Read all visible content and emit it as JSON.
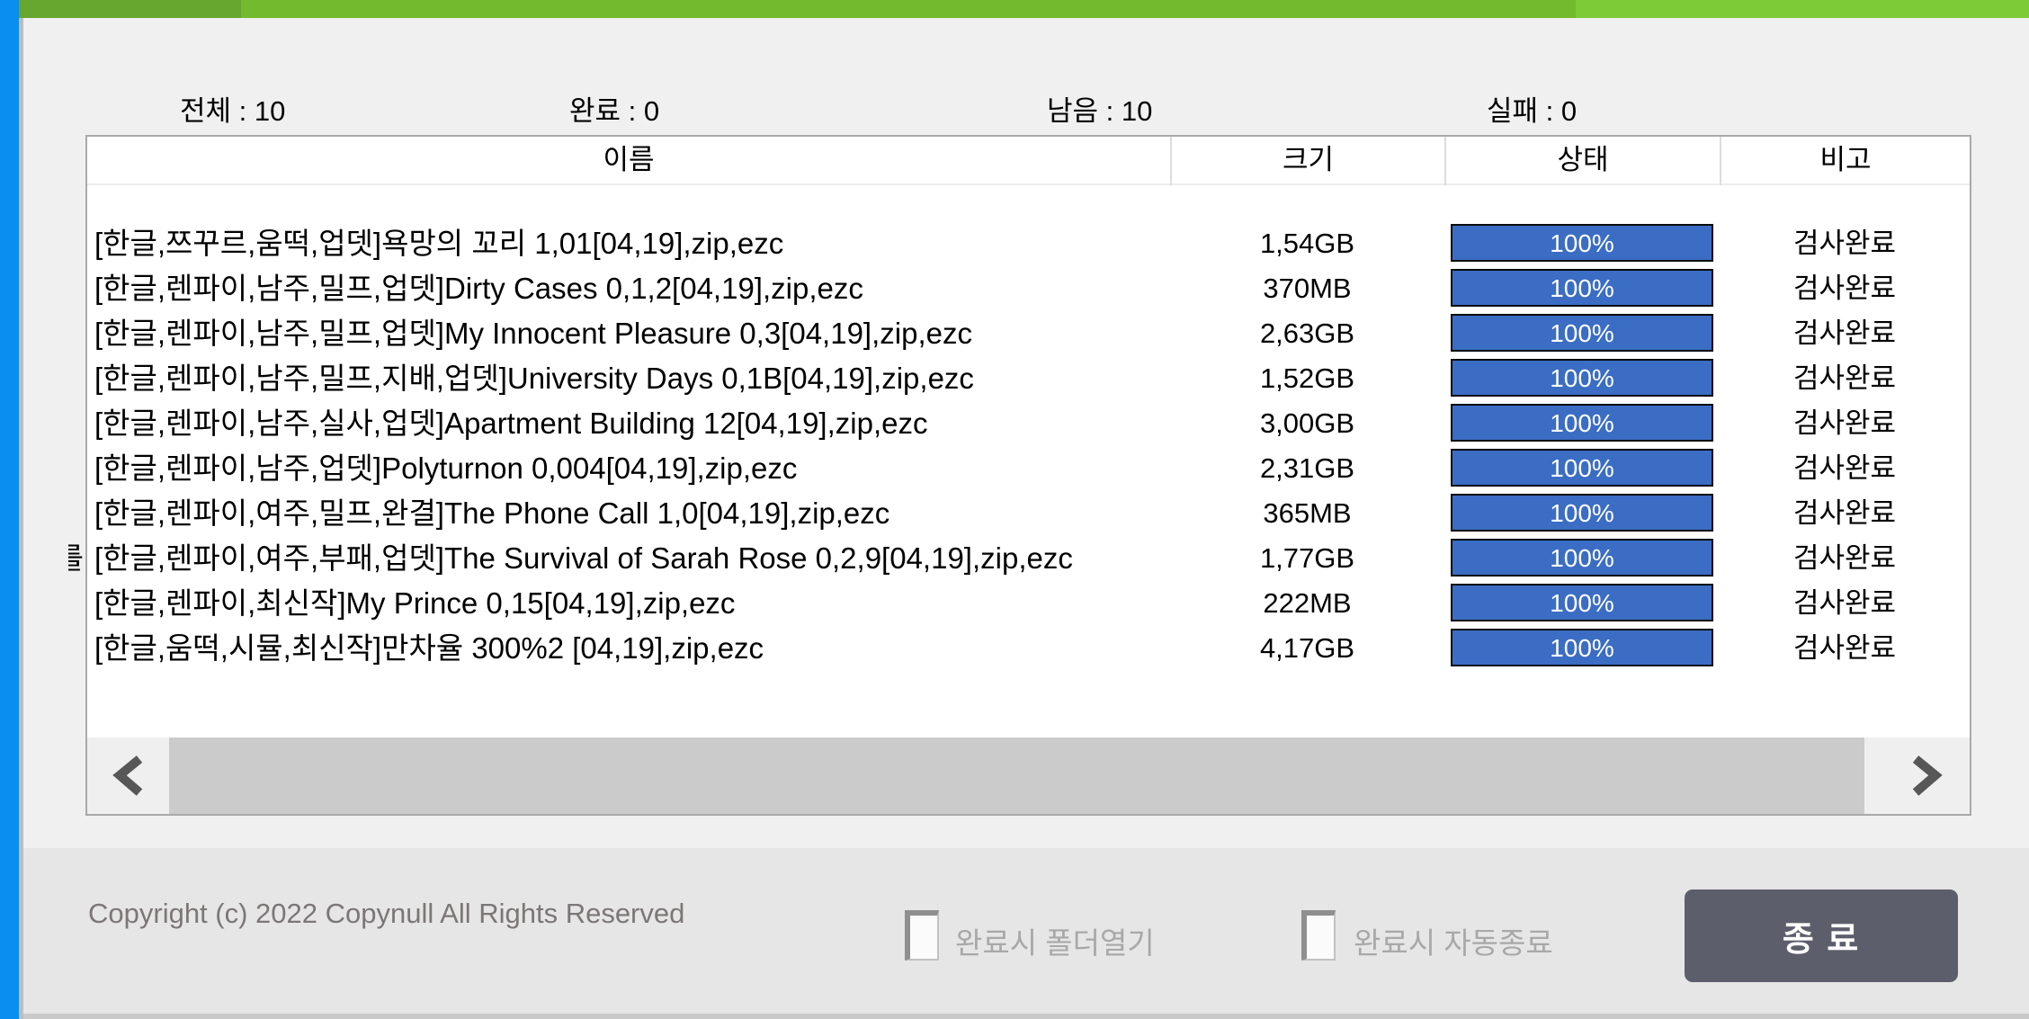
{
  "window": {
    "left_stripe_color": "#0a8ef0",
    "titlebar_colors": {
      "left": "#67a72f",
      "middle": "#73ba2c",
      "right": "#7ecb38"
    }
  },
  "stats": {
    "items": [
      {
        "text": "전체 : 10"
      },
      {
        "text": "완료 : 0"
      },
      {
        "text": "남음 : 10"
      },
      {
        "text": "실패 : 0"
      }
    ]
  },
  "table": {
    "columns": [
      "이름",
      "크기",
      "상태",
      "비고"
    ],
    "rows": [
      {
        "name": "[한글,쯔꾸르,움떡,업뎃]욕망의 꼬리 1,01[04,19],zip,ezc",
        "size": "1,54GB",
        "progress": "100%",
        "percent": 100,
        "note": "검사완료"
      },
      {
        "name": "[한글,렌파이,남주,밀프,업뎃]Dirty Cases 0,1,2[04,19],zip,ezc",
        "size": "370MB",
        "progress": "100%",
        "percent": 100,
        "note": "검사완료"
      },
      {
        "name": "[한글,렌파이,남주,밀프,업뎃]My Innocent Pleasure 0,3[04,19],zip,ezc",
        "size": "2,63GB",
        "progress": "100%",
        "percent": 100,
        "note": "검사완료"
      },
      {
        "name": "[한글,렌파이,남주,밀프,지배,업뎃]University Days 0,1B[04,19],zip,ezc",
        "size": "1,52GB",
        "progress": "100%",
        "percent": 100,
        "note": "검사완료"
      },
      {
        "name": "[한글,렌파이,남주,실사,업뎃]Apartment Building 12[04,19],zip,ezc",
        "size": "3,00GB",
        "progress": "100%",
        "percent": 100,
        "note": "검사완료"
      },
      {
        "name": "[한글,렌파이,남주,업뎃]Polyturnon 0,004[04,19],zip,ezc",
        "size": "2,31GB",
        "progress": "100%",
        "percent": 100,
        "note": "검사완료"
      },
      {
        "name": "[한글,렌파이,여주,밀프,완결]The Phone Call 1,0[04,19],zip,ezc",
        "size": "365MB",
        "progress": "100%",
        "percent": 100,
        "note": "검사완료"
      },
      {
        "name": "[한글,렌파이,여주,부패,업뎃]The Survival of Sarah Rose 0,2,9[04,19],zip,ezc",
        "clipped_prefix": "를",
        "size": "1,77GB",
        "progress": "100%",
        "percent": 100,
        "note": "검사완료"
      },
      {
        "name": "[한글,렌파이,최신작]My Prince 0,15[04,19],zip,ezc",
        "size": "222MB",
        "progress": "100%",
        "percent": 100,
        "note": "검사완료"
      },
      {
        "name": "[한글,움떡,시뮬,최신작]만차율 300%2 [04,19],zip,ezc",
        "size": "4,17GB",
        "progress": "100%",
        "percent": 100,
        "note": "검사완료"
      }
    ]
  },
  "scrollbar": {
    "left_icon": "chevron-left",
    "right_icon": "chevron-right"
  },
  "footer": {
    "copyright": "Copyright (c) 2022 Copynull All Rights Reserved",
    "checkboxes": [
      {
        "label": "완료시 폴더열기",
        "checked": false
      },
      {
        "label": "완료시 자동종료",
        "checked": false
      }
    ],
    "close_button": "종 료"
  },
  "colors": {
    "progress_fill": "#3a6dc3",
    "progress_border": "#0a0a0a",
    "button_bg": "#5c5f6b",
    "scroll_thumb": "#cbcbcb",
    "footer_bg": "#e6e6e6",
    "window_bg": "#f0f0f0"
  }
}
